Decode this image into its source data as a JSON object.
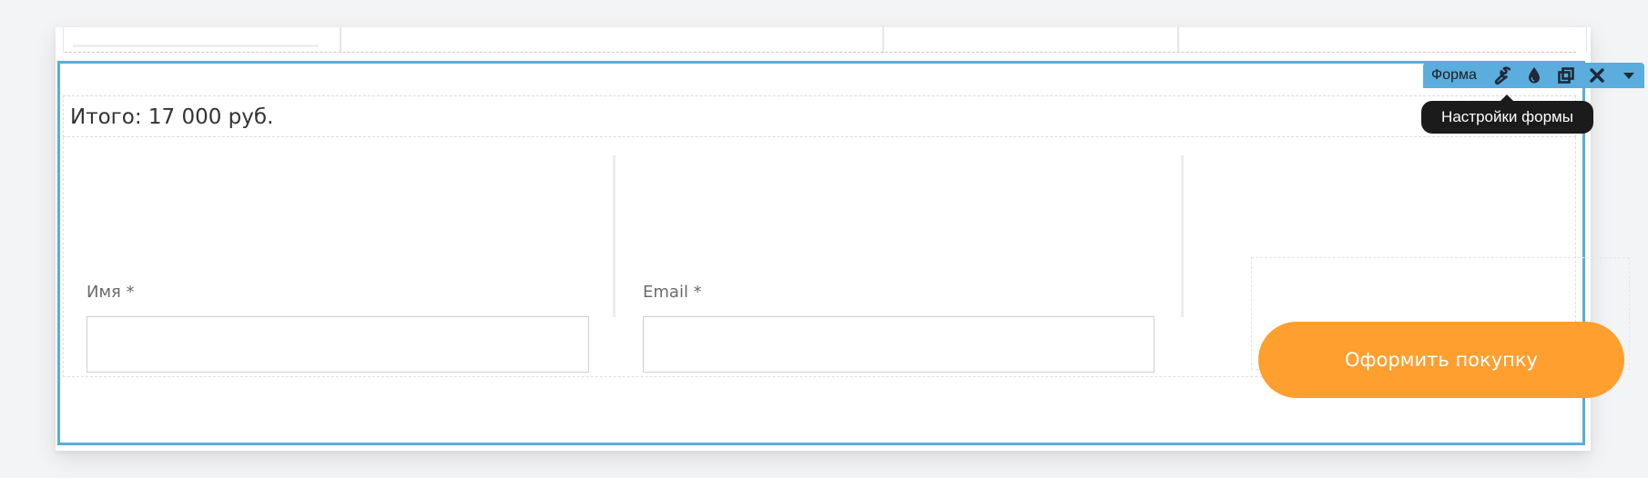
{
  "form": {
    "total": "Итого: 17 000 руб.",
    "fields": [
      {
        "label": "Имя *",
        "value": "",
        "placeholder": ""
      },
      {
        "label": "Email *",
        "value": "",
        "placeholder": ""
      }
    ],
    "submit_label": "Оформить покупку"
  },
  "toolbar": {
    "label": "Форма",
    "icons": [
      "wrench-icon",
      "drop-icon",
      "duplicate-icon",
      "close-icon",
      "caret-down-icon"
    ],
    "tooltip": "Настройки формы"
  },
  "colors": {
    "selection": "#5aaddc",
    "button": "#ff9f2f",
    "tooltip_bg": "#1b1b1b"
  }
}
